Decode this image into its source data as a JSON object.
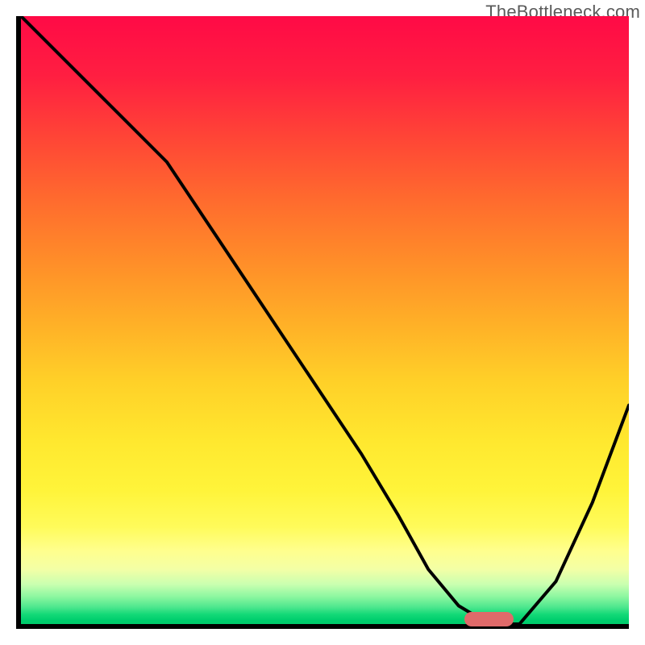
{
  "watermark": {
    "text": "TheBottleneck.com"
  },
  "colors": {
    "marker": "#e06a6a",
    "curve_stroke": "#000000"
  },
  "chart_data": {
    "type": "line",
    "title": "",
    "xlabel": "",
    "ylabel": "",
    "xlim": [
      0,
      1
    ],
    "ylim": [
      0,
      1
    ],
    "grid": false,
    "background": "vertical-gradient red→orange→yellow→green",
    "series": [
      {
        "name": "bottleneck-curve",
        "x": [
          0.0,
          0.08,
          0.16,
          0.24,
          0.32,
          0.4,
          0.48,
          0.56,
          0.62,
          0.67,
          0.72,
          0.77,
          0.82,
          0.88,
          0.94,
          1.0
        ],
        "y": [
          1.0,
          0.92,
          0.84,
          0.76,
          0.64,
          0.52,
          0.4,
          0.28,
          0.18,
          0.09,
          0.03,
          0.0,
          0.0,
          0.07,
          0.2,
          0.36
        ]
      }
    ],
    "annotations": [
      {
        "name": "optimal-range-marker",
        "type": "hrange",
        "x0": 0.73,
        "x1": 0.81,
        "y": 0.0,
        "color": "#e06a6a"
      }
    ]
  }
}
